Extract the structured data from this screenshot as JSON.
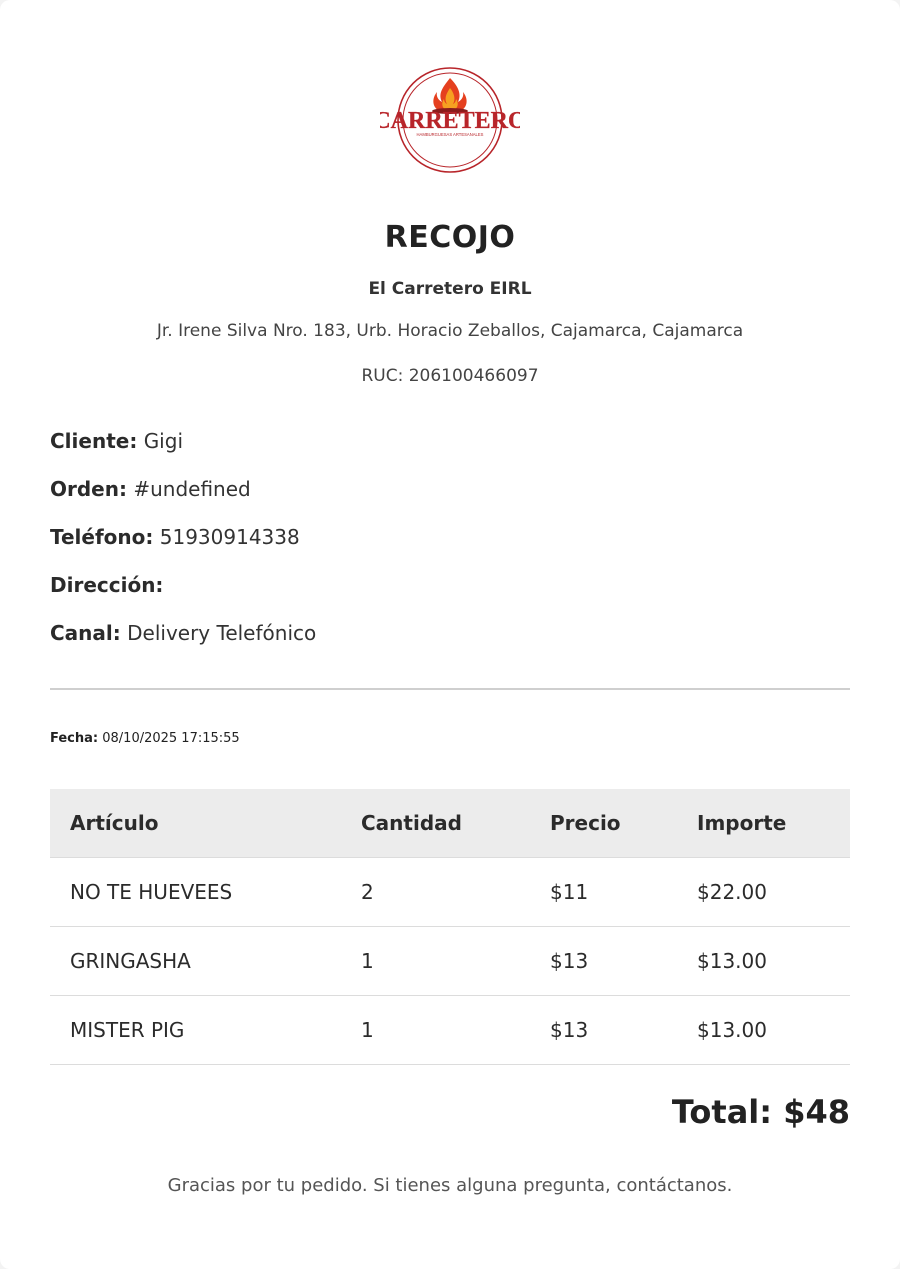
{
  "logo": {
    "brand": "CARRETERO",
    "tagline": "HAMBURGUESAS ARTESANALES"
  },
  "receipt": {
    "title": "RECOJO",
    "company": "El Carretero EIRL",
    "address": "Jr. Irene Silva Nro. 183, Urb. Horacio Zeballos, Cajamarca, Cajamarca",
    "ruc": "RUC: 206100466097"
  },
  "customer": {
    "cliente_label": "Cliente:",
    "cliente_value": "Gigi",
    "orden_label": "Orden:",
    "orden_value": "#undefined",
    "telefono_label": "Teléfono:",
    "telefono_value": "51930914338",
    "direccion_label": "Dirección:",
    "direccion_value": "",
    "canal_label": "Canal:",
    "canal_value": "Delivery Telefónico"
  },
  "fecha": {
    "label": "Fecha:",
    "value": "08/10/2025 17:15:55"
  },
  "table": {
    "headers": [
      "Artículo",
      "Cantidad",
      "Precio",
      "Importe"
    ],
    "rows": [
      [
        "NO TE HUEVEES",
        "2",
        "$11",
        "$22.00"
      ],
      [
        "GRINGASHA",
        "1",
        "$13",
        "$13.00"
      ],
      [
        "MISTER PIG",
        "1",
        "$13",
        "$13.00"
      ]
    ]
  },
  "total": "Total: $48",
  "footer": "Gracias por tu pedido. Si tienes alguna pregunta, contáctanos.",
  "colors": {
    "brand_red": "#b8252a",
    "flame_orange": "#f07a1a",
    "header_bg": "#ececec"
  }
}
